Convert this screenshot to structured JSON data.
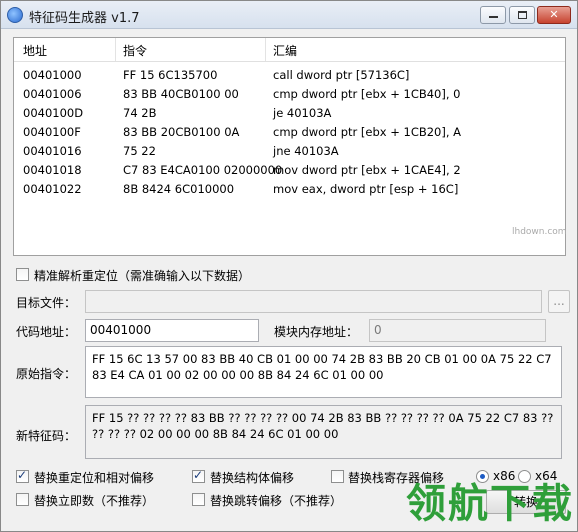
{
  "window": {
    "title": "特征码生成器 v1.7",
    "controls": {
      "minimize_icon": "minimize-icon",
      "maximize_icon": "maximize-icon",
      "close_icon": "close-icon",
      "close_glyph": "✕"
    }
  },
  "listview": {
    "headers": [
      "地址",
      "指令",
      "汇编"
    ],
    "rows": [
      [
        "00401000",
        "FF 15 6C135700",
        "call dword ptr [57136C]"
      ],
      [
        "00401006",
        "83 BB 40CB0100 00",
        "cmp dword ptr [ebx + 1CB40], 0"
      ],
      [
        "0040100D",
        "74 2B",
        "je 40103A"
      ],
      [
        "0040100F",
        "83 BB 20CB0100 0A",
        "cmp dword ptr [ebx + 1CB20], A"
      ],
      [
        "00401016",
        "75 22",
        "jne 40103A"
      ],
      [
        "00401018",
        "C7 83 E4CA0100 02000000",
        "mov dword ptr [ebx + 1CAE4], 2"
      ],
      [
        "00401022",
        "8B 8424 6C010000",
        "mov eax, dword ptr [esp + 16C]"
      ]
    ]
  },
  "form": {
    "precise_reloc_label": "精准解析重定位（需准确输入以下数据）",
    "precise_reloc_checked": false,
    "target_file_label": "目标文件：",
    "target_file_value": "",
    "browse_label": "...",
    "code_address_label": "代码地址：",
    "code_address_value": "00401000",
    "module_mem_label": "模块内存地址：",
    "module_mem_value": "0",
    "original_label": "原始指令：",
    "original_value": "FF 15 6C 13 57 00 83 BB 40 CB 01 00 00 74 2B 83 BB 20 CB 01 00 0A 75 22 C7 83 E4 CA 01 00 02 00 00 00 8B 84 24 6C 01 00 00",
    "signature_label": "新特征码：",
    "signature_value": "FF 15 ?? ?? ?? ?? 83 BB ?? ?? ?? ?? 00 74 2B 83 BB ?? ?? ?? ?? 0A 75 22 C7 83 ?? ?? ?? ?? 02 00 00 00 8B 84 24 6C 01 00 00"
  },
  "options": {
    "replace_reloc": {
      "label": "替换重定位和相对偏移",
      "checked": true
    },
    "replace_struct": {
      "label": "替换结构体偏移",
      "checked": true
    },
    "replace_stack": {
      "label": "替换栈寄存器偏移",
      "checked": false
    },
    "replace_imm": {
      "label": "替换立即数（不推荐）",
      "checked": false
    },
    "replace_jump": {
      "label": "替换跳转偏移（不推荐）",
      "checked": false
    },
    "arch_x86": {
      "label": "x86",
      "selected": true
    },
    "arch_x64": {
      "label": "x64",
      "selected": false
    },
    "convert_label": "转换"
  },
  "watermark": {
    "text": "领航下载",
    "url": "lhdown.com"
  },
  "colors": {
    "title_bg": "#dfe7f2",
    "close_red": "#c7432f",
    "watermark_green": "#2f9f3a"
  }
}
